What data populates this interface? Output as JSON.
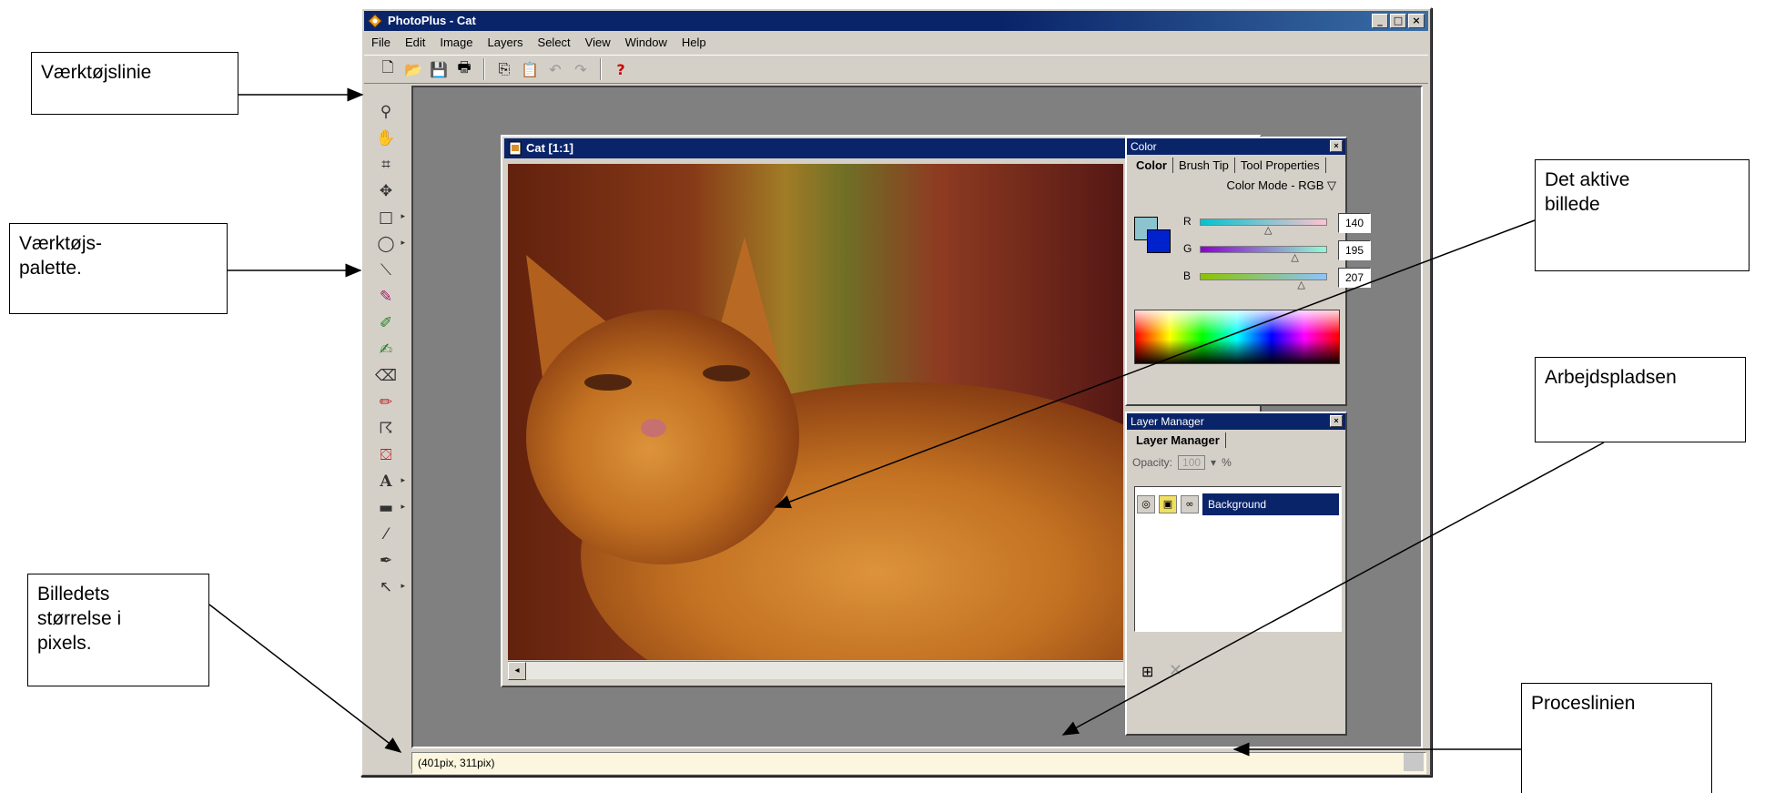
{
  "window": {
    "title": "PhotoPlus - Cat",
    "controls": [
      "_",
      "□",
      "×"
    ]
  },
  "menu": [
    "File",
    "Edit",
    "Image",
    "Layers",
    "Select",
    "View",
    "Window",
    "Help"
  ],
  "document": {
    "title": "Cat [1:1]"
  },
  "color_panel": {
    "title": "Color",
    "tabs": [
      "Color",
      "Brush Tip",
      "Tool Properties"
    ],
    "mode_label": "Color Mode - RGB",
    "mode_arrow": "▽",
    "channels": [
      {
        "label": "R",
        "value": "140",
        "level": 0.55
      },
      {
        "label": "G",
        "value": "195",
        "level": 0.76
      },
      {
        "label": "B",
        "value": "207",
        "level": 0.81
      }
    ]
  },
  "layer_panel": {
    "title": "Layer Manager",
    "tab": "Layer Manager",
    "opacity_label": "Opacity:",
    "opacity_value": "100",
    "opacity_unit": "%",
    "layer_name": "Background"
  },
  "statusbar": {
    "text": "(401pix, 311pix)"
  },
  "annotations": {
    "toolbar": "Værktøjslinie",
    "tool_palette": "Værktøjs-\npalette.",
    "image_size": "Billedets\nstørrelse i\npixels.",
    "active_image": "Det aktive\nbillede",
    "workspace": "Arbejdspladsen",
    "status_line": "Proceslinien"
  }
}
